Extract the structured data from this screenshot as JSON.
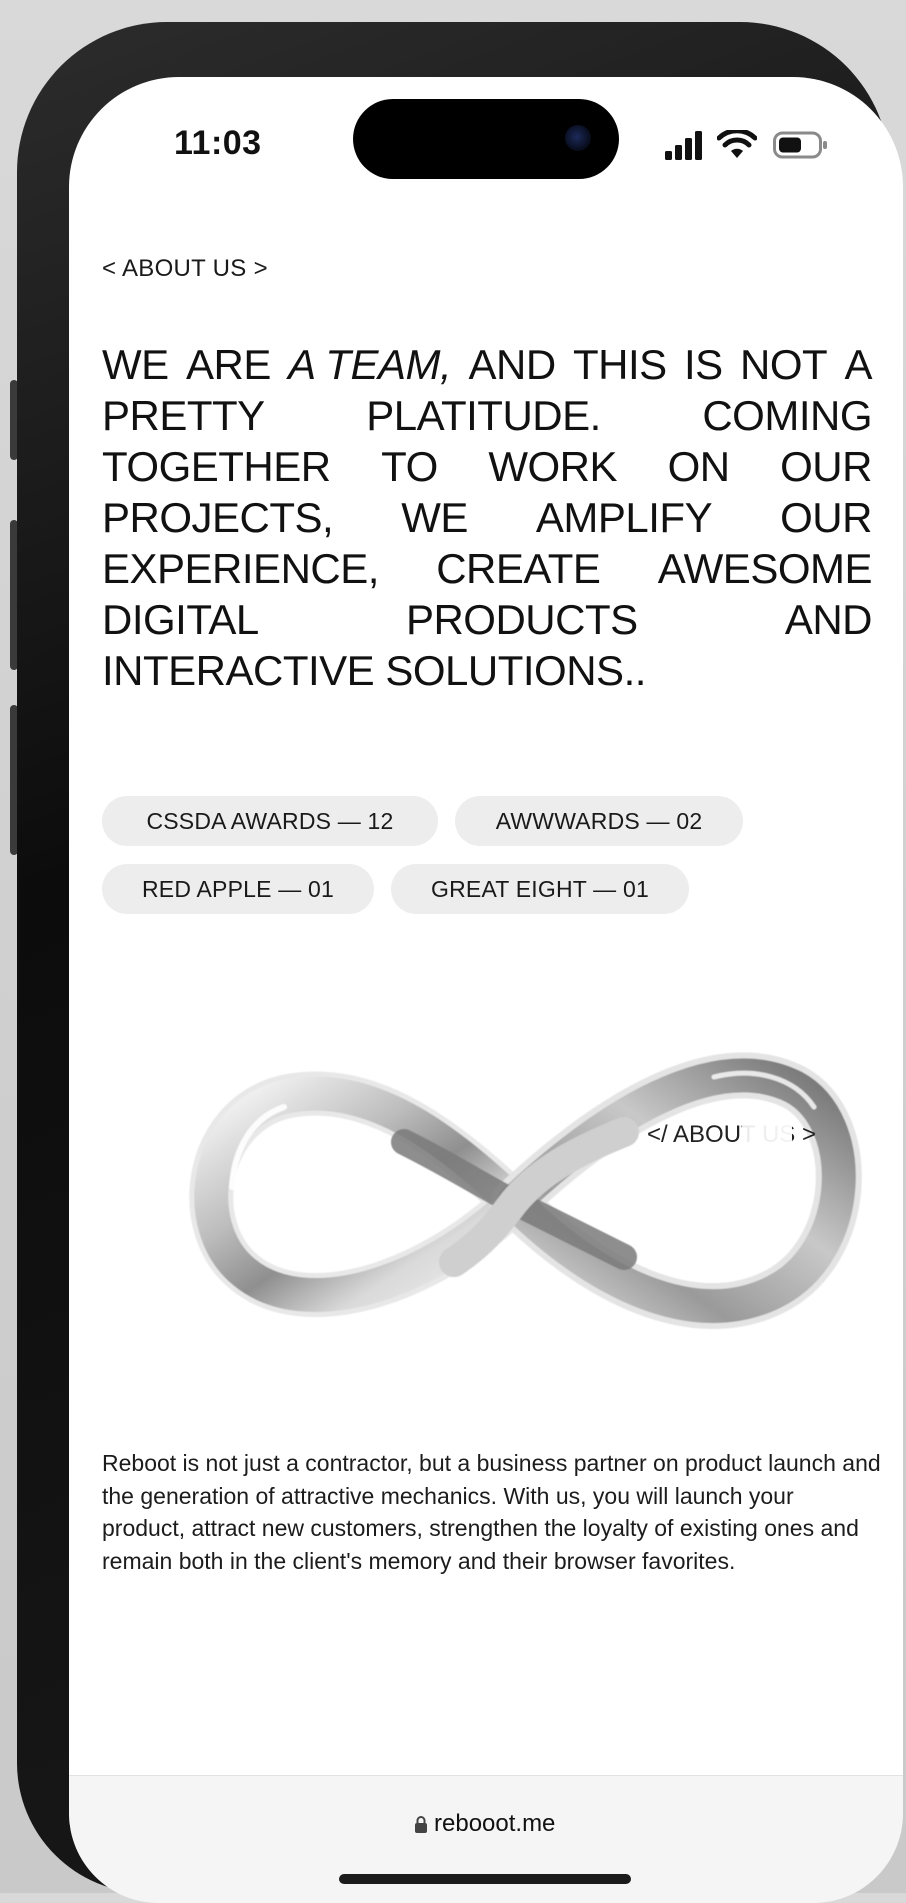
{
  "status_bar": {
    "time": "11:03",
    "icons": [
      "signal-icon",
      "wifi-icon",
      "battery-icon"
    ]
  },
  "section": {
    "eyebrow": "< ABOUT US >",
    "headline_lines": [
      [
        "WE",
        "ARE",
        "A TEAM,",
        "AND",
        "THIS",
        "IS",
        "NOT",
        "A"
      ],
      [
        "PRETTY",
        "PLATITUDE.",
        "COMING"
      ],
      [
        "TOGETHER",
        "TO",
        "WORK",
        "ON",
        "OUR"
      ],
      [
        "PROJECTS,",
        "WE",
        "AMPLIFY",
        "OUR"
      ],
      [
        "EXPERIENCE,",
        "CREATE",
        "AWESOME"
      ],
      [
        "DIGITAL",
        "PRODUCTS",
        "AND"
      ],
      [
        "INTERACTIVE SOLUTIONS.."
      ]
    ],
    "headline_emphasis": "A TEAM",
    "closing_tag": "</ ABOUT US >"
  },
  "awards": [
    {
      "label": "CSSDA AWARDS — 12"
    },
    {
      "label": "AWWWARDS — 02"
    },
    {
      "label": "RED APPLE — 01"
    },
    {
      "label": "GREAT EIGHT — 01"
    }
  ],
  "paragraph": "Reboot is not just a contractor, but a business partner on product launch and the generation of attractive mechanics. With us, you will launch your product, attract new customers, strengthen the loyalty of existing ones and remain both in the client's memory and their browser favorites.",
  "browser": {
    "url": "rebooot.me",
    "lock_icon": "lock-icon"
  },
  "colors": {
    "background": "#ffffff",
    "text": "#111111",
    "chip_bg": "#ededed",
    "phone_frame": "#111111"
  }
}
